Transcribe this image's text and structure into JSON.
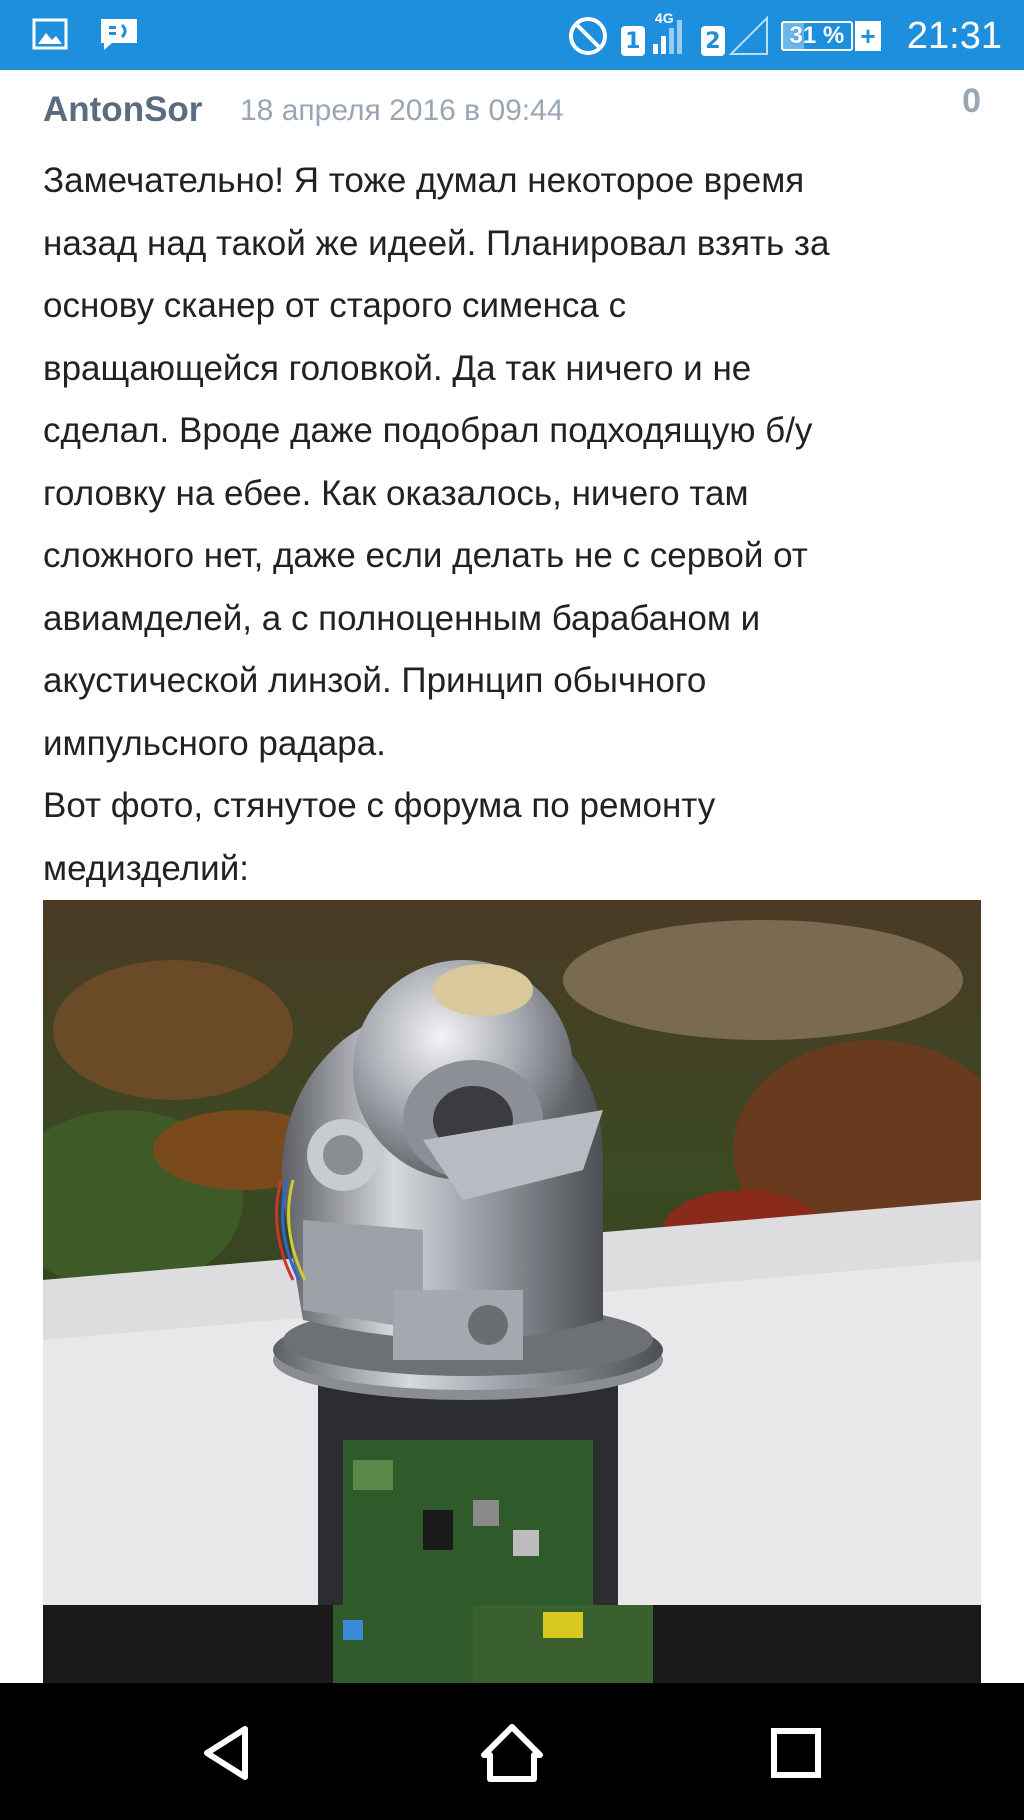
{
  "status_bar": {
    "left_icons": [
      "gallery-icon",
      "message-icon"
    ],
    "sim1": "1",
    "network_type": "4G",
    "sim2": "2",
    "battery_percent": "31 %",
    "battery_level": 0.31,
    "charging_plus": "+",
    "time": "21:31"
  },
  "comment": {
    "author": "AntonSor",
    "date": "18 апреля 2016 в 09:44",
    "score": "0",
    "text": "Замечательно! Я тоже думал некоторое время\nназад над такой же идеей. Планировал взять за\nоснову сканер от старого сименса с\nвращающейся головкой. Да так ничего и не\nсделал. Вроде даже подобрал подходящую б/у\nголовку на ебее. Как оказалось, ничего там\nсложного нет, даже если делать не с сервой от\nавиамделей, а с полноценным барабаном и\nакустической линзой. Принцип обычного\nимпульсного радара.\nВот фото, стянутое с форума по ремонту\nмедизделий:"
  },
  "nav_bar": {
    "buttons": [
      "back-icon",
      "home-icon",
      "recents-icon"
    ]
  }
}
